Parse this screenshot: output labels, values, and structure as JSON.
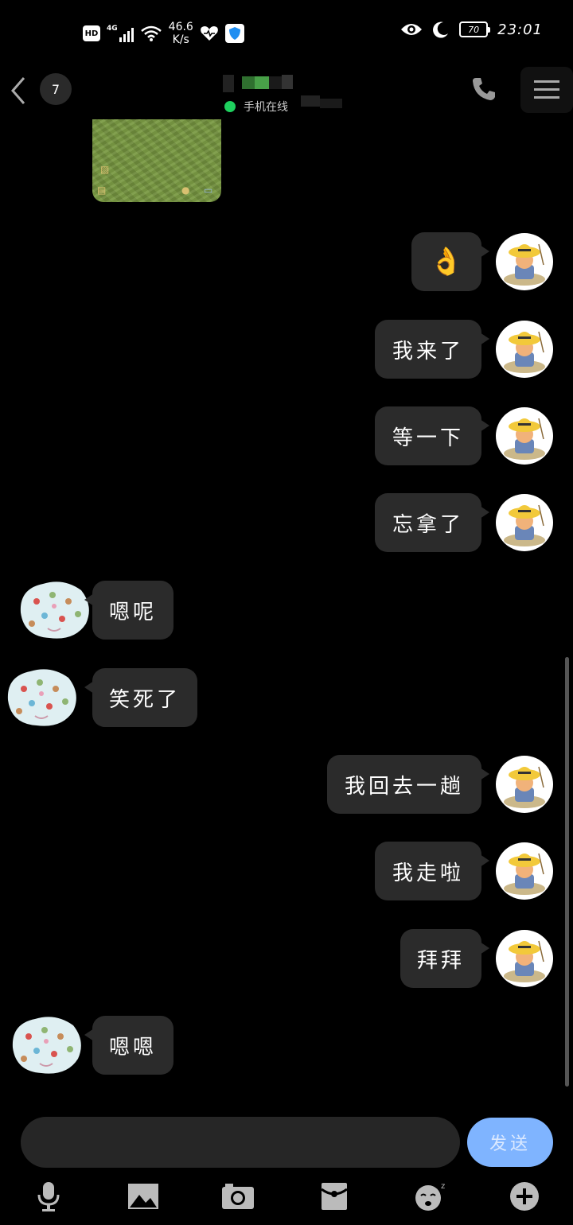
{
  "status_bar": {
    "hd": "HD",
    "network": "4G",
    "speed_value": "46.6",
    "speed_unit": "K/s",
    "battery": "70",
    "time": "23:01"
  },
  "header": {
    "unread_badge": "7",
    "online_status": "手机在线"
  },
  "messages": [
    {
      "side": "out",
      "text": "👌"
    },
    {
      "side": "out",
      "text": "我来了"
    },
    {
      "side": "out",
      "text": "等一下"
    },
    {
      "side": "out",
      "text": "忘拿了"
    },
    {
      "side": "in",
      "text": "嗯呢"
    },
    {
      "side": "in",
      "text": "笑死了"
    },
    {
      "side": "out",
      "text": "我回去一趟"
    },
    {
      "side": "out",
      "text": "我走啦"
    },
    {
      "side": "out",
      "text": "拜拜"
    },
    {
      "side": "in",
      "text": "嗯嗯"
    }
  ],
  "composer": {
    "input_value": "",
    "send_label": "发送"
  },
  "toolbar": {
    "items": [
      "microphone-icon",
      "image-icon",
      "camera-icon",
      "red-packet-icon",
      "emoji-icon",
      "plus-icon"
    ]
  },
  "colors": {
    "bubble": "#2b2b2b",
    "send_button": "#7fb4ff",
    "online_dot": "#1ed05e"
  }
}
